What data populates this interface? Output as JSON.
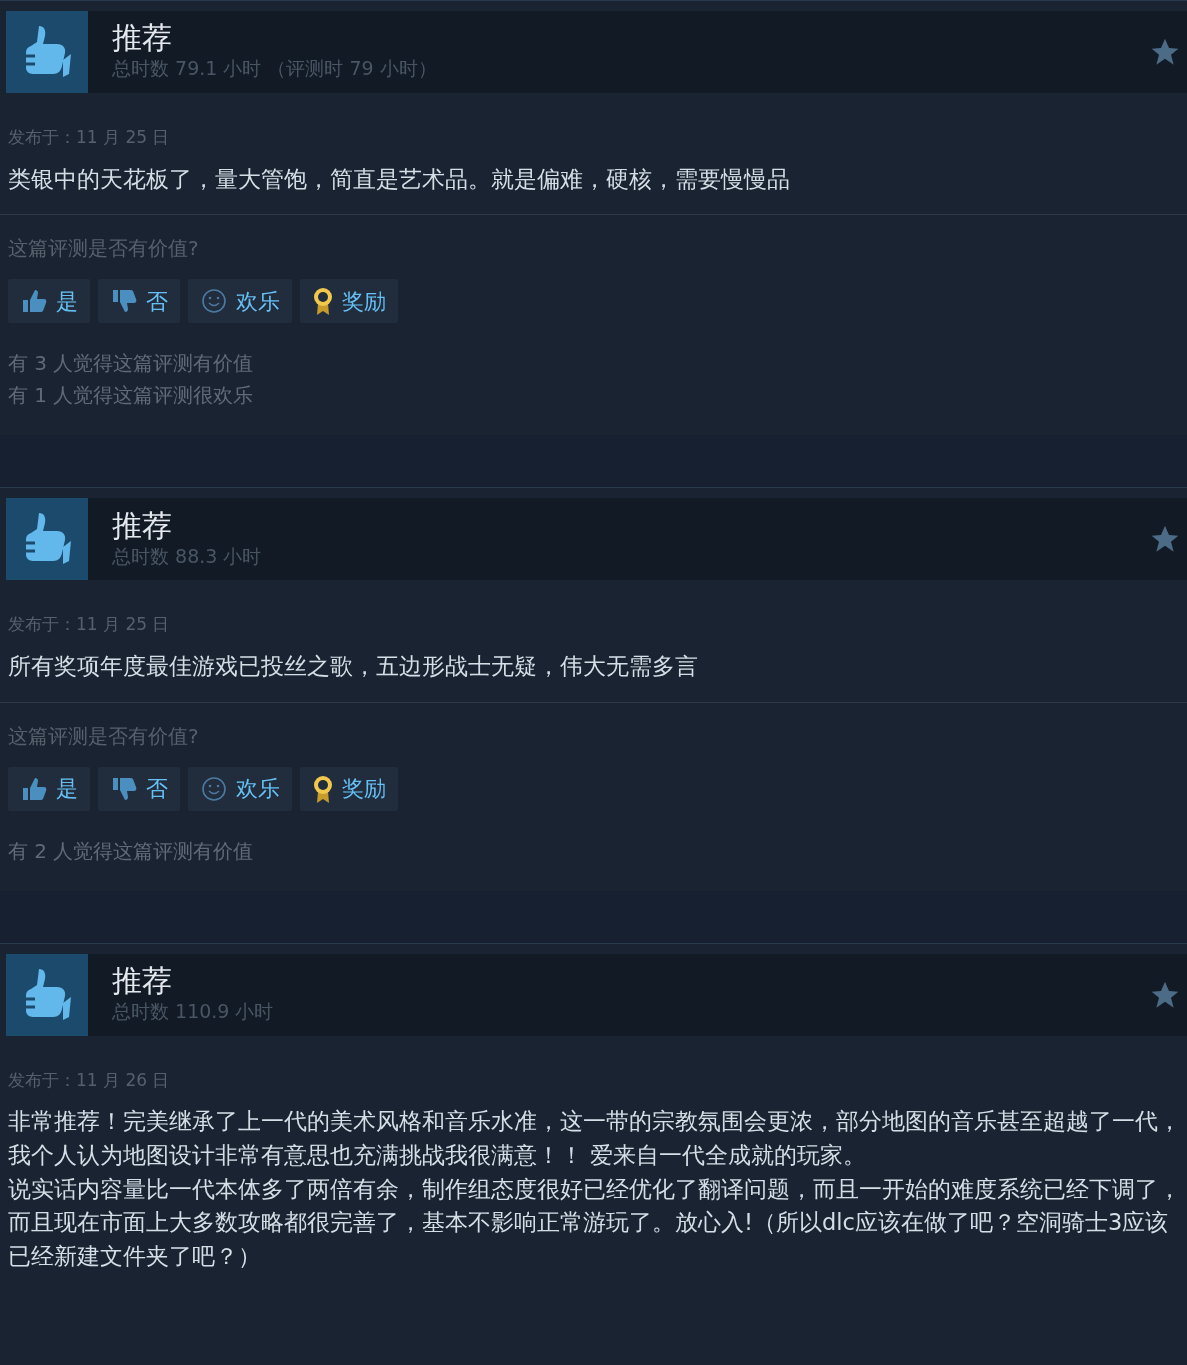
{
  "reviews": [
    {
      "title": "推荐",
      "recommended": true,
      "hours": "总时数 79.1 小时 （评测时 79 小时）",
      "date": "发布于：11 月 25 日",
      "body": [
        "类银中的天花板了，量大管饱，简直是艺术品。就是偏难，硬核，需要慢慢品"
      ],
      "question": "这篇评测是否有价值?",
      "buttons": [
        {
          "kind": "yes",
          "label": "是"
        },
        {
          "kind": "no",
          "label": "否"
        },
        {
          "kind": "funny",
          "label": "欢乐"
        },
        {
          "kind": "award",
          "label": "奖励"
        }
      ],
      "counts": [
        "有 3 人觉得这篇评测有价值",
        "有 1 人觉得这篇评测很欢乐"
      ]
    },
    {
      "title": "推荐",
      "recommended": true,
      "hours": "总时数 88.3 小时",
      "date": "发布于：11 月 25 日",
      "body": [
        "所有奖项年度最佳游戏已投丝之歌，五边形战士无疑，伟大无需多言"
      ],
      "question": "这篇评测是否有价值?",
      "buttons": [
        {
          "kind": "yes",
          "label": "是"
        },
        {
          "kind": "no",
          "label": "否"
        },
        {
          "kind": "funny",
          "label": "欢乐"
        },
        {
          "kind": "award",
          "label": "奖励"
        }
      ],
      "counts": [
        "有 2 人觉得这篇评测有价值"
      ]
    },
    {
      "title": "推荐",
      "recommended": true,
      "hours": "总时数 110.9 小时",
      "date": "发布于：11 月 26 日",
      "body": [
        "非常推荐！完美继承了上一代的美术风格和音乐水准，这一带的宗教氛围会更浓，部分地图的音乐甚至超越了一代，我个人认为地图设计非常有意思也充满挑战我很满意！！ 爱来自一代全成就的玩家。",
        "说实话内容量比一代本体多了两倍有余，制作组态度很好已经优化了翻译问题，而且一开始的难度系统已经下调了，而且现在市面上大多数攻略都很完善了，基本不影响正常游玩了。放心入!（所以dlc应该在做了吧？空洞骑士3应该已经新建文件夹了吧？）"
      ]
    }
  ]
}
